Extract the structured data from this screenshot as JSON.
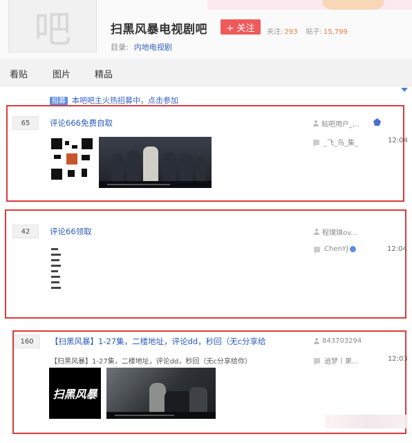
{
  "header": {
    "forum_name": "扫黑风暴电视剧吧",
    "follow_label": "+ 关注",
    "followers_label": "关注:",
    "followers_count": "293",
    "posts_label": "贴子:",
    "posts_count": "15,799",
    "directory_label": "目录:",
    "directory_value": "内地电视剧",
    "avatar_glyph": "吧"
  },
  "tabs": [
    {
      "label": "看贴"
    },
    {
      "label": "图片"
    },
    {
      "label": "精品"
    }
  ],
  "notice": {
    "tag": "招募",
    "text": "本吧吧主火热招募中，点击参加"
  },
  "threads": [
    {
      "reply_count": "65",
      "title": "评论666免费自取",
      "author": "贴吧用户_...",
      "last_replier": "_飞_鸟_集_",
      "time": "12:04"
    },
    {
      "reply_count": "42",
      "title": "评论66领取",
      "author": "程璞琪ov...",
      "last_replier": "ChenYJ",
      "time": "12:04"
    },
    {
      "reply_count": "160",
      "title": "【扫黑风暴】1-27集，二楼地址，评论dd，秒回（无c分享给",
      "desc": "【扫黑风暴】1-27集，二楼地址，评论dd，秒回（无c分享给你）",
      "author": "843703294",
      "last_replier": "逍梦丨果...",
      "time": "12:03",
      "logo_text": "扫黑风暴"
    }
  ],
  "colors": {
    "highlight_border": "#d83b3b",
    "link_blue": "#2b5bc2",
    "follow_red": "#ef5a5a",
    "count_orange": "#f07a3c"
  },
  "icons": [
    "person-icon",
    "reply-icon",
    "member-badge-icon",
    "verified-dot-icon"
  ]
}
